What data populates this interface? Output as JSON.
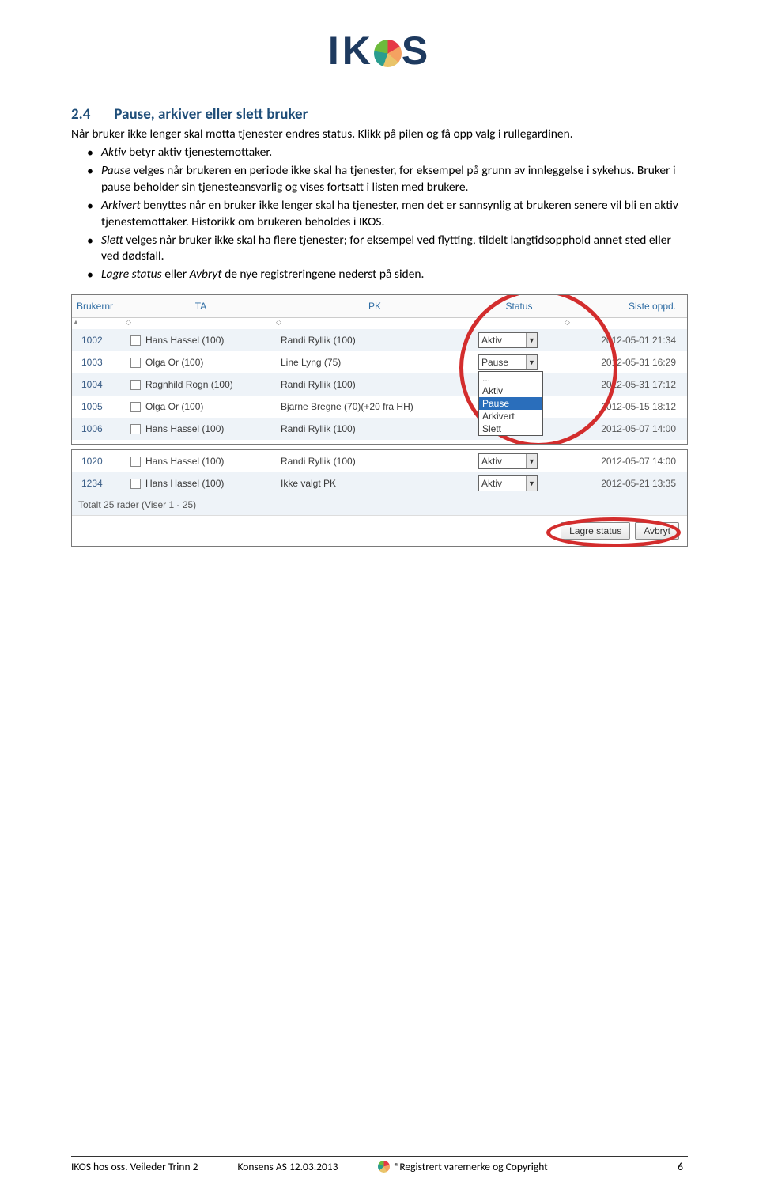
{
  "logo": {
    "prefix": "IK",
    "suffix": "S"
  },
  "heading": {
    "num": "2.4",
    "title": "Pause, arkiver eller slett bruker"
  },
  "intro": "Når bruker ikke lenger skal motta tjenester endres status. Klikk på pilen og få opp valg i rullegardinen.",
  "bullets": {
    "b1_em": "Aktiv",
    "b1_rest": " betyr aktiv tjenestemottaker.",
    "b2_em": "Pause",
    "b2_rest": " velges når brukeren en periode ikke skal ha tjenester, for eksempel på grunn av innleggelse i sykehus. Bruker i pause beholder sin tjenesteansvarlig og vises fortsatt i listen med brukere.",
    "b3_em": "Arkivert",
    "b3_rest": " benyttes når en bruker ikke lenger skal ha tjenester, men det er sannsynlig at brukeren senere vil bli en aktiv tjenestemottaker. Historikk om brukeren beholdes i IKOS.",
    "b4_em": "Slett",
    "b4_rest": " velges når bruker ikke skal ha flere tjenester; for eksempel ved flytting, tildelt langtidsopphold annet sted eller ved dødsfall.",
    "b5_em1": "Lagre status",
    "b5_mid": " eller ",
    "b5_em2": "Avbryt",
    "b5_rest": " de nye registreringene nederst på siden."
  },
  "table": {
    "headers": {
      "brukernr": "Brukernr",
      "ta": "TA",
      "pk": "PK",
      "status": "Status",
      "siste": "Siste oppd."
    },
    "rows1": [
      {
        "nr": "1002",
        "ta": "Hans Hassel (100)",
        "pk": "Randi Ryllik (100)",
        "status": "Aktiv",
        "oppd": "2012-05-01 21:34"
      },
      {
        "nr": "1003",
        "ta": "Olga Or (100)",
        "pk": "Line Lyng (75)",
        "status": "Pause",
        "oppd": "2012-05-31 16:29"
      },
      {
        "nr": "1004",
        "ta": "Ragnhild Rogn (100)",
        "pk": "Randi Ryllik (100)",
        "status": "",
        "oppd": "2012-05-31 17:12"
      },
      {
        "nr": "1005",
        "ta": "Olga Or (100)",
        "pk": "Bjarne Bregne (70)(+20 fra HH)",
        "status": "",
        "oppd": "2012-05-15 18:12"
      },
      {
        "nr": "1006",
        "ta": "Hans Hassel (100)",
        "pk": "Randi Ryllik (100)",
        "status": "",
        "oppd": "2012-05-07 14:00"
      }
    ],
    "dropdown": {
      "o1": "...",
      "o2": "Aktiv",
      "o3": "Pause",
      "o4": "Arkivert",
      "o5": "Slett"
    },
    "rows2": [
      {
        "nr": "1020",
        "ta": "Hans Hassel (100)",
        "pk": "Randi Ryllik (100)",
        "status": "Aktiv",
        "oppd": "2012-05-07 14:00"
      },
      {
        "nr": "1234",
        "ta": "Hans Hassel (100)",
        "pk": "Ikke valgt PK",
        "status": "Aktiv",
        "oppd": "2012-05-21 13:35"
      }
    ],
    "summary": "Totalt 25 rader (Viser 1 - 25)",
    "buttons": {
      "save": "Lagre status",
      "cancel": "Avbryt"
    }
  },
  "footer": {
    "left": "IKOS hos oss. Veileder Trinn 2",
    "mid": "Konsens AS 12.03.2013",
    "right": "®Registrert varemerke og Copyright",
    "page": "6"
  }
}
